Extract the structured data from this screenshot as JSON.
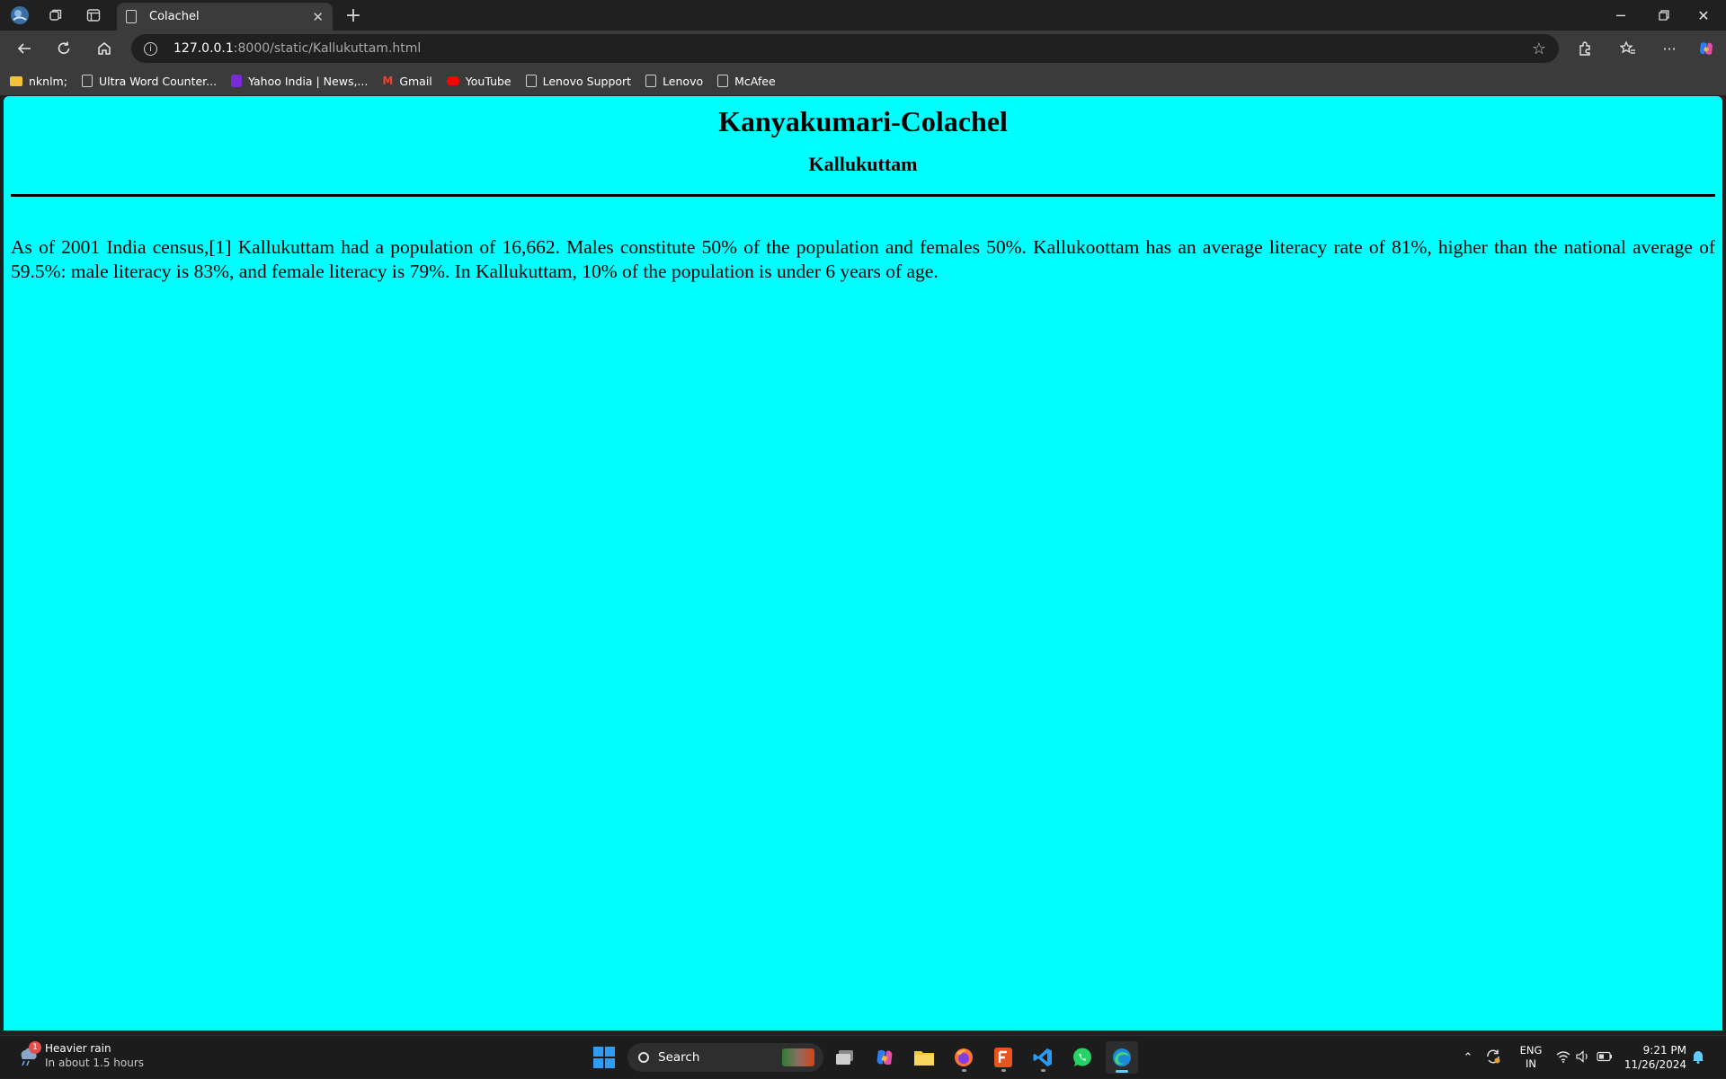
{
  "browser": {
    "tab_title": "Colachel",
    "url_host": "127.0.0.1",
    "url_path": ":8000/static/Kallukuttam.html",
    "bookmarks": [
      {
        "label": "nknlm;",
        "icon": "folder-icon"
      },
      {
        "label": "Ultra Word Counter...",
        "icon": "page-icon"
      },
      {
        "label": "Yahoo India | News,...",
        "icon": "yahoo-icon"
      },
      {
        "label": "Gmail",
        "icon": "gmail-icon"
      },
      {
        "label": "YouTube",
        "icon": "youtube-icon"
      },
      {
        "label": "Lenovo Support",
        "icon": "page-icon"
      },
      {
        "label": "Lenovo",
        "icon": "page-icon"
      },
      {
        "label": "McAfee",
        "icon": "page-icon"
      }
    ]
  },
  "page": {
    "title": "Kanyakumari-Colachel",
    "subtitle": "Kallukuttam",
    "paragraph": "As of 2001 India census,[1] Kallukuttam had a population of 16,662. Males constitute 50% of the population and females 50%. Kallukoottam has an average literacy rate of 81%, higher than the national average of 59.5%: male literacy is 83%, and female literacy is 79%. In Kallukuttam, 10% of the population is under 6 years of age.",
    "background_color": "#00ffff"
  },
  "taskbar": {
    "weather_title": "Heavier rain",
    "weather_detail": "In about 1.5 hours",
    "weather_badge": "1",
    "search_placeholder": "Search",
    "lang_line1": "ENG",
    "lang_line2": "IN",
    "time": "9:21 PM",
    "date": "11/26/2024"
  }
}
